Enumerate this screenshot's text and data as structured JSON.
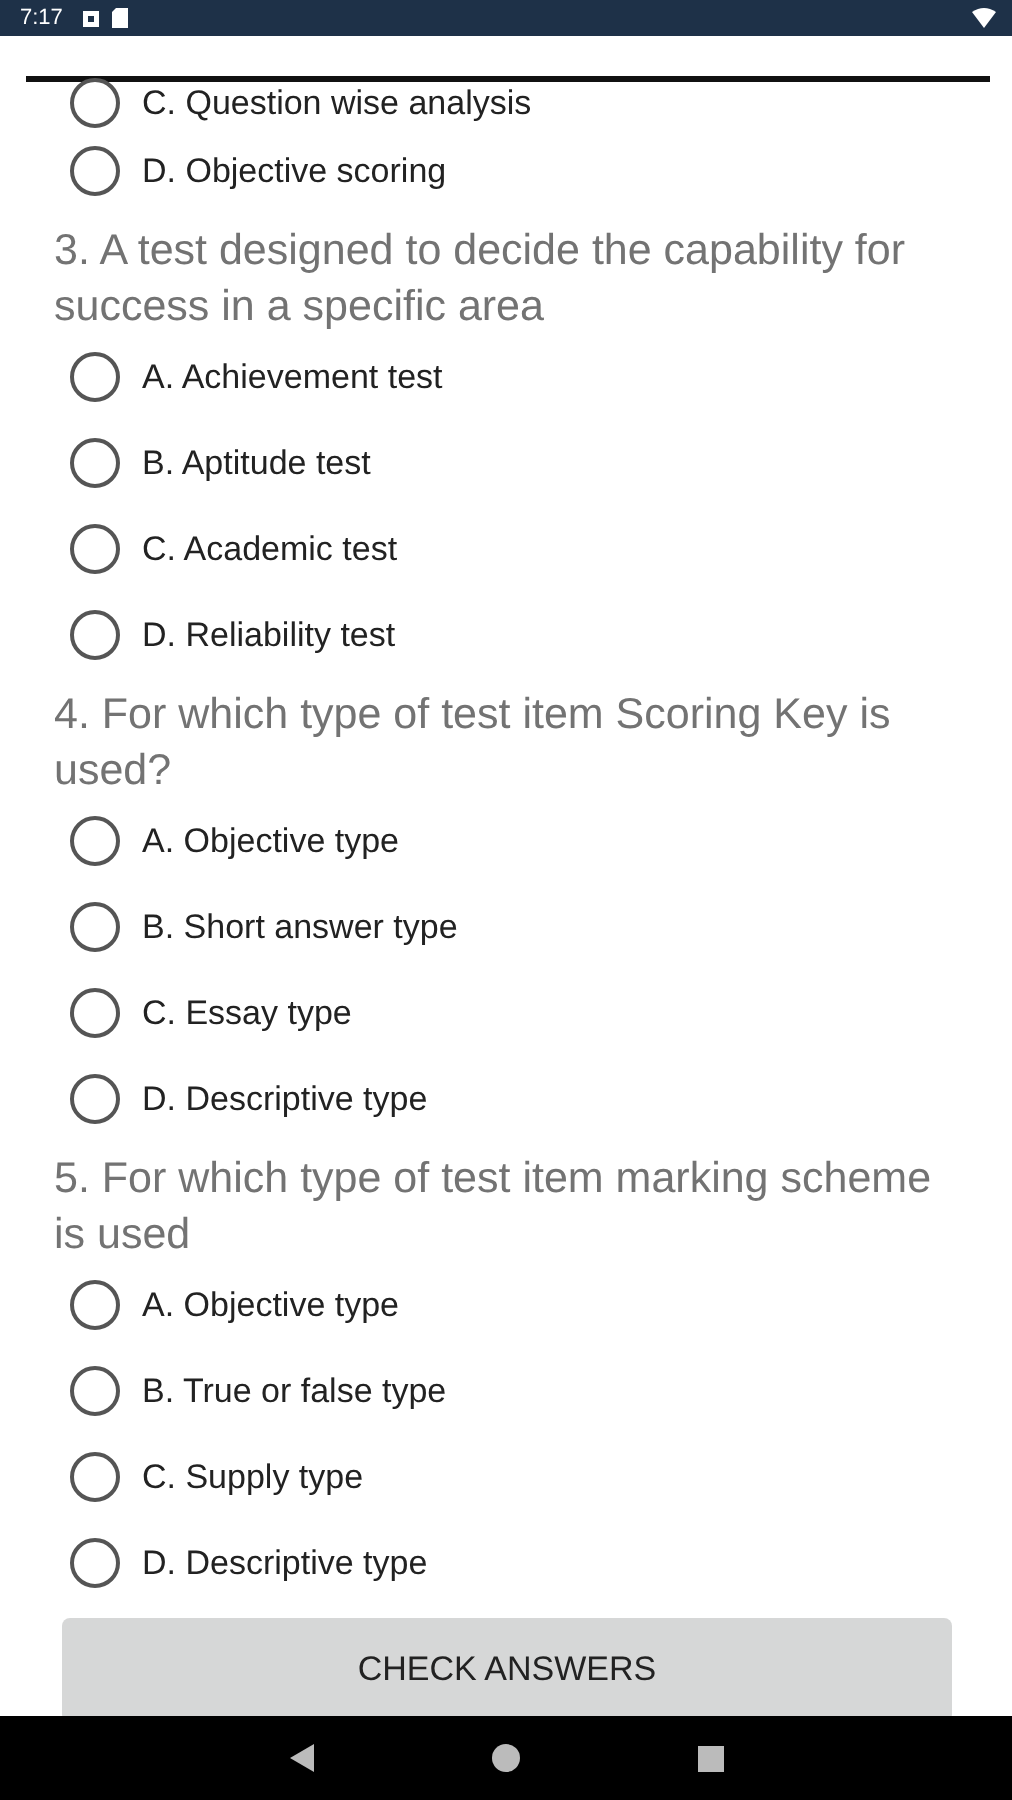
{
  "status_bar": {
    "time": "7:17"
  },
  "questions": [
    {
      "options": [
        {
          "label": "C. Question wise analysis",
          "kind": "cut",
          "selected": false
        },
        {
          "label": "D. Objective scoring",
          "kind": "full",
          "selected": false
        }
      ]
    },
    {
      "text": "3. A test designed to decide the capability for success in a specific area",
      "options": [
        {
          "label": "A. Achievement test",
          "kind": "full",
          "selected": false
        },
        {
          "label": "B. Aptitude test",
          "kind": "full",
          "selected": false
        },
        {
          "label": "C. Academic test",
          "kind": "full",
          "selected": false
        },
        {
          "label": "D. Reliability test",
          "kind": "full",
          "selected": false
        }
      ]
    },
    {
      "text": "4. For which type of test item Scoring Key is used?",
      "options": [
        {
          "label": "A. Objective type",
          "kind": "full",
          "selected": false
        },
        {
          "label": "B. Short answer type",
          "kind": "full",
          "selected": false
        },
        {
          "label": "C. Essay type",
          "kind": "full",
          "selected": false
        },
        {
          "label": "D. Descriptive type",
          "kind": "full",
          "selected": false
        }
      ]
    },
    {
      "text": "5. For which type of test item marking scheme is used",
      "options": [
        {
          "label": "A. Objective type",
          "kind": "full",
          "selected": false
        },
        {
          "label": "B. True or false type",
          "kind": "full",
          "selected": false
        },
        {
          "label": "C. Supply type",
          "kind": "full",
          "selected": false
        },
        {
          "label": "D. Descriptive type",
          "kind": "full",
          "selected": false
        }
      ]
    }
  ],
  "button": "CHECK ANSWERS"
}
